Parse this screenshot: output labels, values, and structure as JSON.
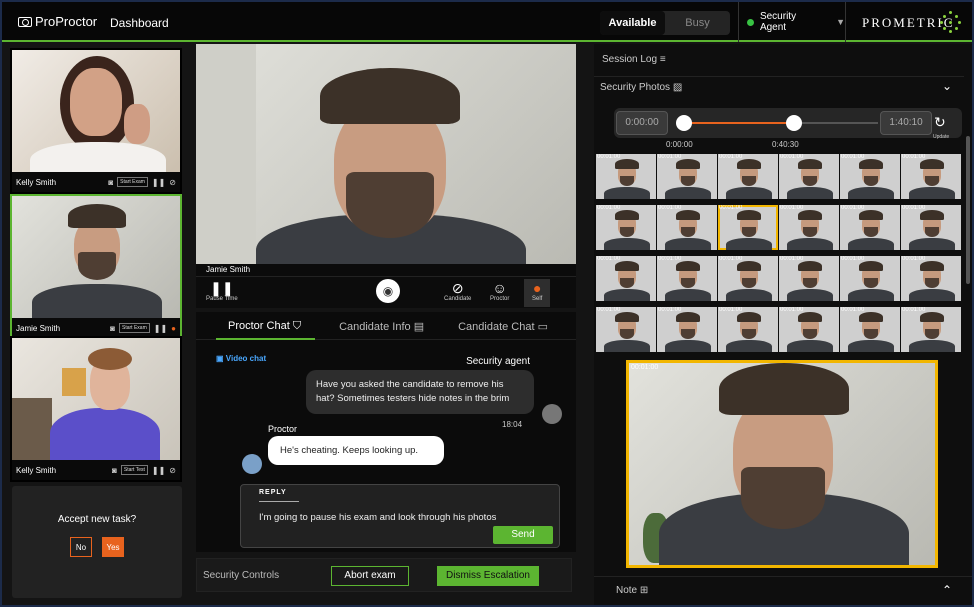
{
  "app": {
    "logo": "ProProctor",
    "nav_title": "Dashboard"
  },
  "status_toggle": {
    "available": "Available",
    "busy": "Busy"
  },
  "agent": {
    "label": "Security Agent",
    "status_color": "#38c243"
  },
  "brand": {
    "name": "PROMETRIC"
  },
  "candidates": [
    {
      "name": "Kelly Smith",
      "action": "Start Exam"
    },
    {
      "name": "Jamie Smith",
      "action": "Start Exam"
    },
    {
      "name": "Kelly Smith",
      "action": "Start Test"
    }
  ],
  "task": {
    "question": "Accept new task?",
    "no": "No",
    "yes": "Yes"
  },
  "main_video": {
    "candidate_name": "Jamie Smith",
    "controls": {
      "pause": "Pause Time",
      "candidate": "Candidate",
      "proctor": "Proctor",
      "self": "Self"
    }
  },
  "chat": {
    "tabs": [
      "Proctor Chat",
      "Candidate Info",
      "Candidate Chat"
    ],
    "video_chat": "Video chat",
    "messages": [
      {
        "sender": "Security agent",
        "text": "Have you asked the candidate to remove his hat? Sometimes testers hide notes in the brim",
        "time": "18:04"
      },
      {
        "sender": "Proctor",
        "text": "He's cheating. Keeps looking up."
      }
    ],
    "reply": {
      "label": "REPLY",
      "text": "I'm going to pause his exam and look through his photos",
      "send": "Send"
    }
  },
  "security_controls": {
    "label": "Security Controls",
    "abort": "Abort exam",
    "dismiss": "Dismiss Escalation"
  },
  "session": {
    "log_label": "Session Log",
    "photos_label": "Security Photos",
    "range": {
      "start": "0:00:00",
      "end": "1:40:10",
      "handle_start": "0:00:00",
      "handle_end": "0:40:30",
      "update": "Update"
    },
    "thumb_timestamp": "00:01:00",
    "preview_timestamp": "00:01:00",
    "selected_index": 8,
    "note_label": "Note"
  },
  "colors": {
    "accent_green": "#5cb531",
    "accent_orange": "#e8631e",
    "selection": "#f2b600"
  }
}
